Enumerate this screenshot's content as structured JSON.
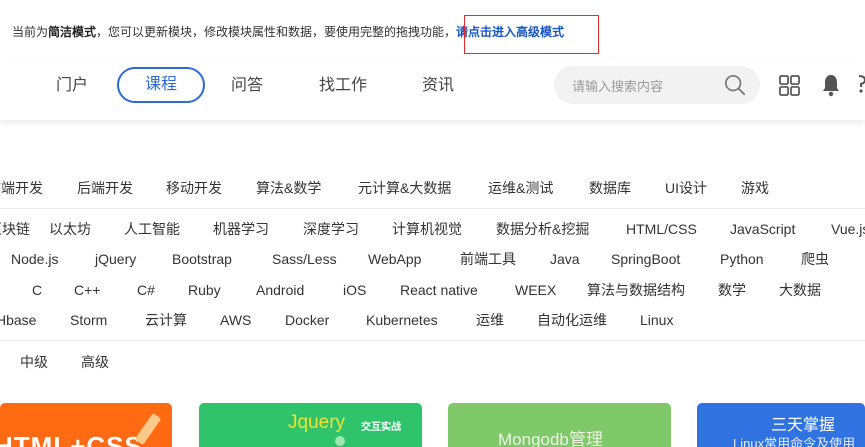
{
  "notice": {
    "prefix": "当前为",
    "mode": "简洁模式",
    "middle": "，您可以更新模块，修改模块属性和数据，要使用完整的拖拽功能，",
    "link": "请点击进入高级模式"
  },
  "nav": {
    "items": [
      {
        "label": "门户",
        "active": false
      },
      {
        "label": "课程",
        "active": true
      },
      {
        "label": "问答",
        "active": false
      },
      {
        "label": "找工作",
        "active": false
      },
      {
        "label": "资讯",
        "active": false
      }
    ],
    "search_placeholder": "请输入搜索内容",
    "icons": [
      "search-icon",
      "apps-grid-icon",
      "bell-icon"
    ]
  },
  "categories": {
    "row1": [
      "前端开发",
      "后端开发",
      "移动开发",
      "算法&数学",
      "元计算&大数据",
      "运维&测试",
      "数据库",
      "UI设计",
      "游戏"
    ],
    "row2": [
      "区块链",
      "以太坊",
      "人工智能",
      "机器学习",
      "深度学习",
      "计算机视觉",
      "数据分析&挖掘",
      "HTML/CSS",
      "JavaScript",
      "Vue.js"
    ],
    "row3": [
      "Node.js",
      "jQuery",
      "Bootstrap",
      "Sass/Less",
      "WebApp",
      "前端工具",
      "Java",
      "SpringBoot",
      "Python",
      "爬虫"
    ],
    "row4": [
      "C",
      "C++",
      "C#",
      "Ruby",
      "Android",
      "iOS",
      "React native",
      "WEEX",
      "算法与数据结构",
      "数学",
      "大数据"
    ],
    "row5": [
      "Hbase",
      "Storm",
      "云计算",
      "AWS",
      "Docker",
      "Kubernetes",
      "运维",
      "自动化运维",
      "Linux"
    ]
  },
  "levels": [
    "中级",
    "高级"
  ],
  "cards": [
    {
      "text": "HTML+CSS",
      "color": "#ff6a13"
    },
    {
      "text": "Jquery",
      "badge": "交互实战",
      "color": "#2fc46b"
    },
    {
      "text": "Mongodb管理",
      "color": "#7fc96a"
    },
    {
      "title": "三天掌握",
      "subtitle": "Linux常用命令及使用",
      "color": "#2f72e0"
    }
  ],
  "colors": {
    "accent": "#2d6ad8",
    "link": "#1a56c6",
    "highlight_border": "#e52a2a"
  }
}
